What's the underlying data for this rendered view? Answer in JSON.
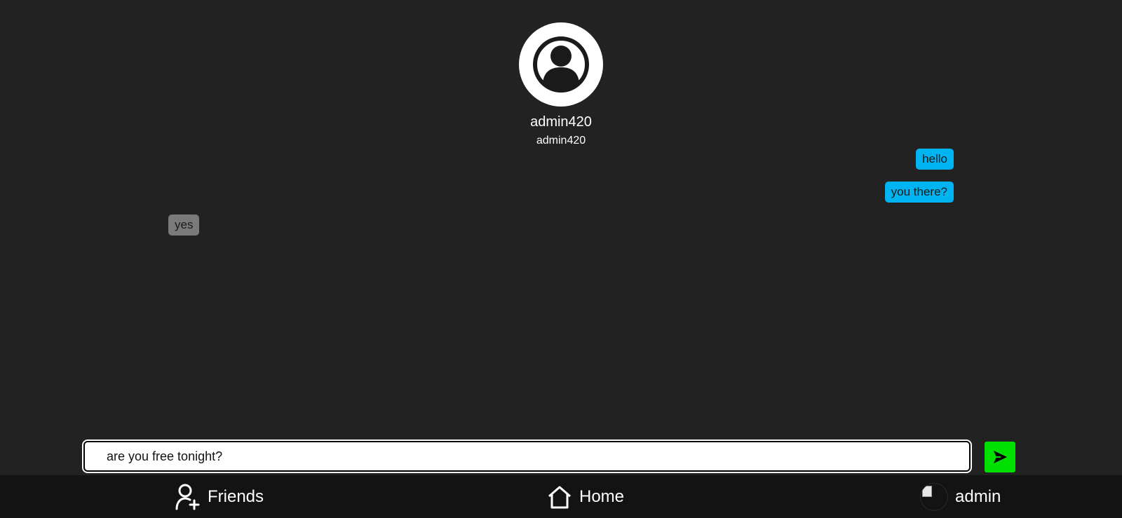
{
  "profile": {
    "display_name": "admin420",
    "username": "admin420",
    "avatar_icon": "user-circle-icon"
  },
  "messages": [
    {
      "text": "hello",
      "direction": "sent"
    },
    {
      "text": "you there?",
      "direction": "sent"
    },
    {
      "text": "yes",
      "direction": "received"
    }
  ],
  "compose": {
    "value": "are you free tonight?",
    "send_icon": "send-arrow-icon"
  },
  "nav": {
    "friends_label": "Friends",
    "home_label": "Home",
    "profile_label": "admin"
  },
  "colors": {
    "background": "#222222",
    "sent_bubble": "#00b4f2",
    "received_bubble": "#7a7a7a",
    "send_button": "#00e000",
    "nav_bar": "#131313"
  }
}
